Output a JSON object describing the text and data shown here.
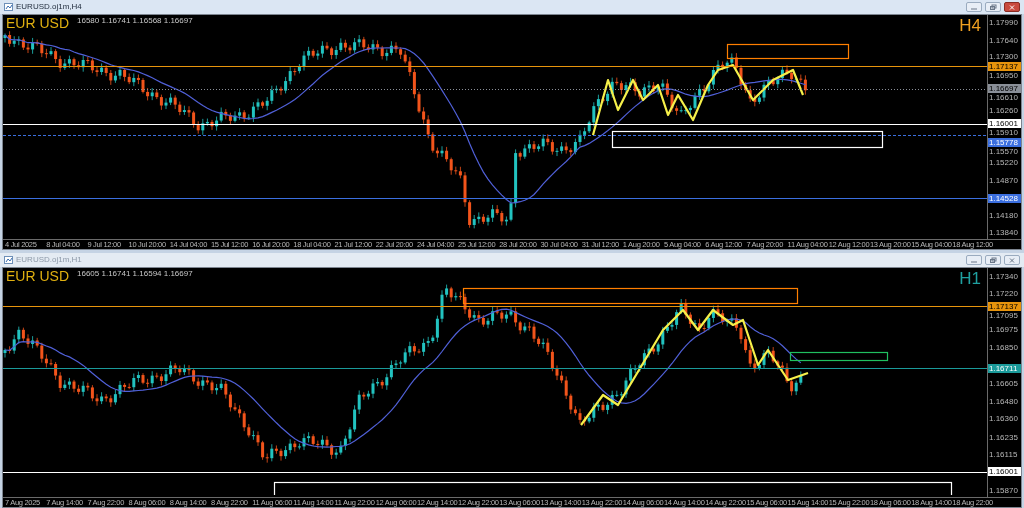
{
  "windows": [
    {
      "title": "EURUSD.oj1m,H4",
      "active": true,
      "symbol": "EUR USD",
      "ohlc": "16580 1.16741 1.16568 1.16697",
      "timeframe": "H4",
      "color": "#f0a020",
      "price_ticks": [
        "1.17990",
        "1.17640",
        "1.17300",
        "1.16950",
        "1.16610",
        "1.16260",
        "1.15910",
        "1.15570",
        "1.15220",
        "1.14870",
        "1.14180",
        "1.13840"
      ],
      "levels": [
        {
          "price": "1.17137",
          "kind": "solid",
          "color": "#e8940c"
        },
        {
          "price": "1.16697",
          "kind": "dotted",
          "color": "#8a8f98"
        },
        {
          "price": "1.16001",
          "kind": "solid",
          "color": "#ffffff"
        },
        {
          "price": "1.15778",
          "kind": "dashed",
          "color": "#3b6fe0"
        },
        {
          "price": "1.14528",
          "kind": "solid",
          "color": "#3b6fe0"
        }
      ],
      "zones": [
        {
          "color": "#ff7f00"
        },
        {
          "color": "#ffffff"
        }
      ],
      "time_labels": [
        "4 Jul 2025",
        "8 Jul 04:00",
        "9 Jul 12:00",
        "10 Jul 20:00",
        "14 Jul 04:00",
        "15 Jul 12:00",
        "16 Jul 20:00",
        "18 Jul 04:00",
        "21 Jul 12:00",
        "22 Jul 20:00",
        "24 Jul 04:00",
        "25 Jul 12:00",
        "28 Jul 20:00",
        "30 Jul 04:00",
        "31 Jul 12:00",
        "1 Aug 20:00",
        "5 Aug 04:00",
        "6 Aug 12:00",
        "7 Aug 20:00",
        "11 Aug 04:00",
        "12 Aug 12:00",
        "13 Aug 20:00",
        "15 Aug 04:00",
        "18 Aug 12:00"
      ]
    },
    {
      "title": "EURUSD.oj1m,H1",
      "active": false,
      "symbol": "EUR USD",
      "ohlc": "16605 1.16741 1.16594 1.16697",
      "timeframe": "H1",
      "color": "#1fa0a0",
      "price_ticks": [
        "1.17340",
        "1.17220",
        "1.17095",
        "1.16975",
        "1.16850",
        "1.16605",
        "1.16480",
        "1.16360",
        "1.16235",
        "1.16115",
        "1.15870"
      ],
      "levels": [
        {
          "price": "1.17137",
          "kind": "solid",
          "color": "#e8940c"
        },
        {
          "price": "1.16711",
          "kind": "solid",
          "color": "#1a9a9a"
        },
        {
          "price": "1.16001",
          "kind": "solid",
          "color": "#ffffff"
        }
      ],
      "zones": [
        {
          "color": "#ff7f00"
        },
        {
          "color": "#20c060"
        },
        {
          "color": "#ffffff"
        }
      ],
      "time_labels": [
        "7 Aug 2025",
        "7 Aug 14:00",
        "7 Aug 22:00",
        "8 Aug 06:00",
        "8 Aug 14:00",
        "8 Aug 22:00",
        "11 Aug 06:00",
        "11 Aug 14:00",
        "11 Aug 22:00",
        "12 Aug 06:00",
        "12 Aug 14:00",
        "12 Aug 22:00",
        "13 Aug 06:00",
        "13 Aug 14:00",
        "13 Aug 22:00",
        "14 Aug 06:00",
        "14 Aug 14:00",
        "14 Aug 22:00",
        "15 Aug 06:00",
        "15 Aug 14:00",
        "15 Aug 22:00",
        "18 Aug 06:00",
        "18 Aug 14:00",
        "18 Aug 22:00"
      ]
    }
  ]
}
